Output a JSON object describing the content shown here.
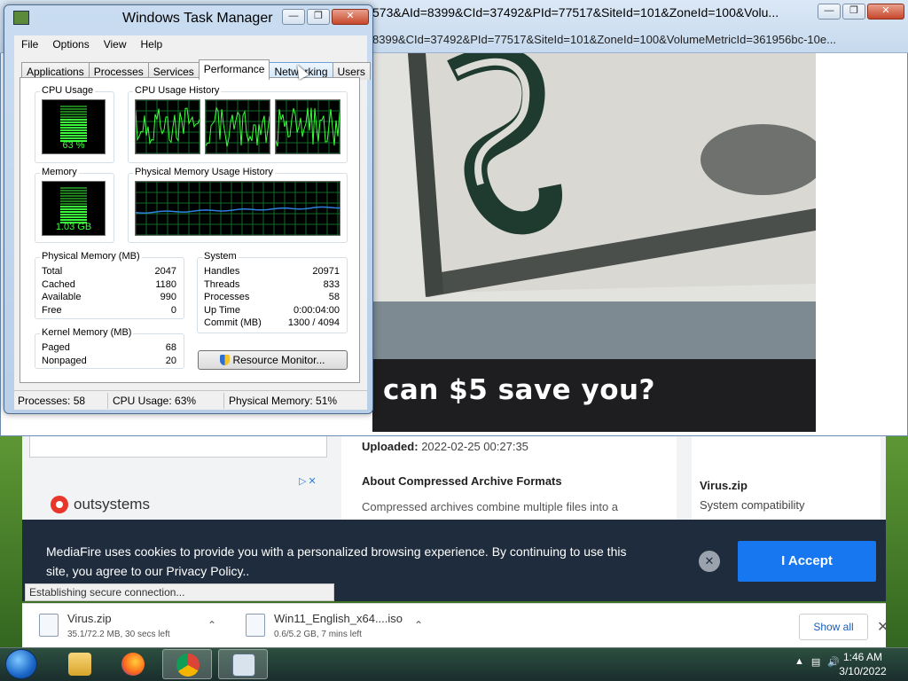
{
  "browser": {
    "url_line1": "573&AId=8399&CId=37492&PId=77517&SiteId=101&ZoneId=100&Volu...",
    "url_line2": "8399&CId=37492&PId=77517&SiteId=101&ZoneId=100&VolumeMetricId=361956bc-10e...",
    "banner_text": "can $5 save you?"
  },
  "mediafire": {
    "uploaded_label": "Uploaded:",
    "uploaded_value": "2022-02-25 00:27:35",
    "about_title": "About Compressed Archive Formats",
    "about_body": "Compressed archives combine multiple files into a",
    "ad_brand": "outsystems",
    "ad_controls": "▷✕",
    "side_title": "Virus.zip",
    "side_sub": "System compatibility",
    "cookie_text": "MediaFire uses cookies to provide you with a personalized browsing experience. By continuing to use this site, you agree to our Privacy Policy..",
    "cookie_close": "✕",
    "accept_label": "I Accept",
    "status_text": "Establishing secure connection..."
  },
  "downloads": {
    "items": [
      {
        "name": "Virus.zip",
        "meta": "35.1/72.2 MB, 30 secs left"
      },
      {
        "name": "Win11_English_x64....iso",
        "meta": "0.6/5.2 GB, 7 mins left"
      }
    ],
    "show_all": "Show all",
    "close": "✕"
  },
  "taskmanager": {
    "title": "Windows Task Manager",
    "menu": [
      "File",
      "Options",
      "View",
      "Help"
    ],
    "tabs": [
      "Applications",
      "Processes",
      "Services",
      "Performance",
      "Networking",
      "Users"
    ],
    "active_tab": "Performance",
    "cpu_usage_label": "CPU Usage",
    "cpu_usage_value": "63 %",
    "cpu_usage_fraction": 0.63,
    "cpu_history_label": "CPU Usage History",
    "memory_label": "Memory",
    "memory_value": "1.03 GB",
    "memory_fraction": 0.51,
    "mem_history_label": "Physical Memory Usage History",
    "physical_memory": {
      "title": "Physical Memory (MB)",
      "rows": [
        {
          "label": "Total",
          "value": "2047"
        },
        {
          "label": "Cached",
          "value": "1180"
        },
        {
          "label": "Available",
          "value": "990"
        },
        {
          "label": "Free",
          "value": "0"
        }
      ]
    },
    "kernel_memory": {
      "title": "Kernel Memory (MB)",
      "rows": [
        {
          "label": "Paged",
          "value": "68"
        },
        {
          "label": "Nonpaged",
          "value": "20"
        }
      ]
    },
    "system": {
      "title": "System",
      "rows": [
        {
          "label": "Handles",
          "value": "20971"
        },
        {
          "label": "Threads",
          "value": "833"
        },
        {
          "label": "Processes",
          "value": "58"
        },
        {
          "label": "Up Time",
          "value": "0:00:04:00"
        },
        {
          "label": "Commit (MB)",
          "value": "1300 / 4094"
        }
      ]
    },
    "resource_monitor": "Resource Monitor...",
    "status": {
      "processes": "Processes: 58",
      "cpu": "CPU Usage: 63%",
      "memory": "Physical Memory: 51%"
    }
  },
  "taskbar": {
    "time": "1:46 AM",
    "date": "3/10/2022"
  },
  "colors": {
    "graph_green": "#3cff3c",
    "graph_grid": "#0f6b2a",
    "mem_line": "#2f7fe0",
    "accept_blue": "#1777f0",
    "cookie_bg": "#1f2c3d"
  }
}
